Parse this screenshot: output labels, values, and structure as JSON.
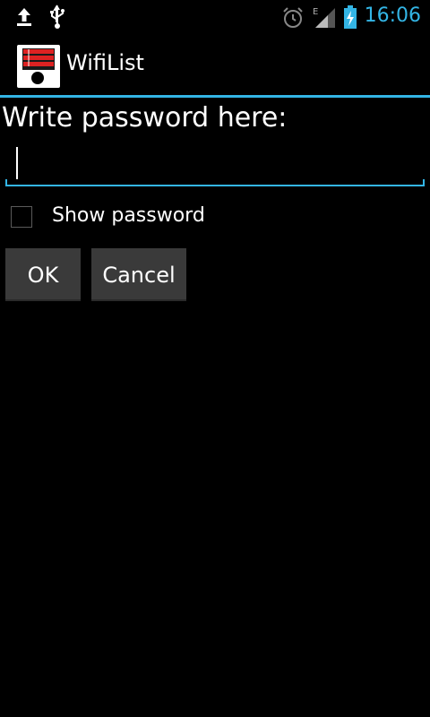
{
  "status_bar": {
    "time": "16:06",
    "network_type": "E",
    "icons": [
      "upload-icon",
      "usb-icon",
      "alarm-icon",
      "signal-icon",
      "battery-charging-icon"
    ],
    "accent_color": "#33b5e5"
  },
  "action_bar": {
    "title": "WifiList",
    "app_icon": "wifilist-app-icon"
  },
  "form": {
    "prompt": "Write password here:",
    "password_value": "",
    "show_password_label": "Show password",
    "show_password_checked": false
  },
  "buttons": {
    "ok_label": "OK",
    "cancel_label": "Cancel"
  },
  "colors": {
    "accent": "#33b5e5",
    "background": "#000000",
    "button_bg": "#3a3a3a"
  }
}
